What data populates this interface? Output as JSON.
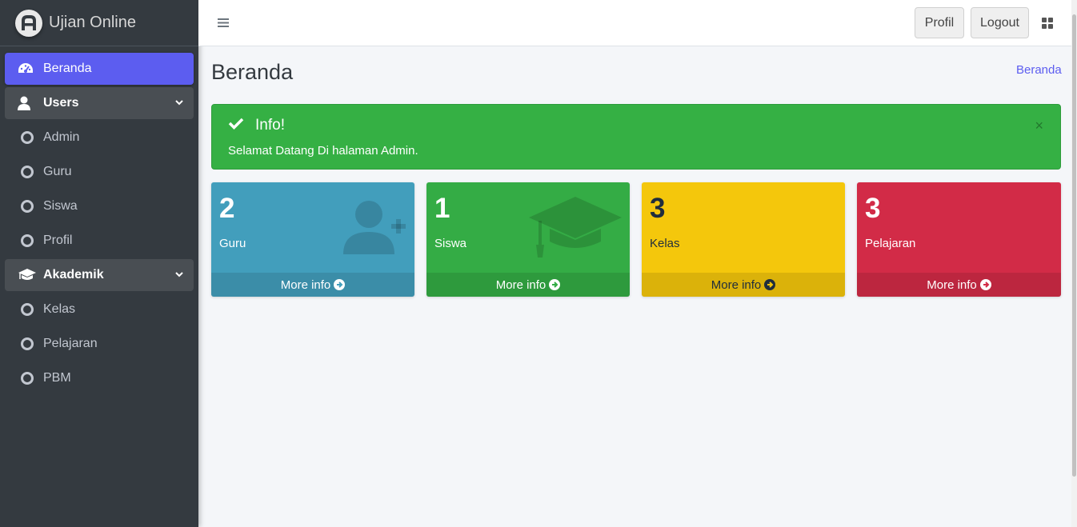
{
  "brand": {
    "name": "Ujian Online"
  },
  "sidebar": {
    "items": [
      {
        "label": "Beranda",
        "icon": "dashboard-icon",
        "state": "active"
      },
      {
        "label": "Users",
        "icon": "user-icon",
        "state": "open"
      },
      {
        "label": "Admin",
        "icon": "circle-icon"
      },
      {
        "label": "Guru",
        "icon": "circle-icon"
      },
      {
        "label": "Siswa",
        "icon": "circle-icon"
      },
      {
        "label": "Profil",
        "icon": "circle-icon"
      },
      {
        "label": "Akademik",
        "icon": "graduation-cap-icon",
        "state": "open"
      },
      {
        "label": "Kelas",
        "icon": "circle-icon"
      },
      {
        "label": "Pelajaran",
        "icon": "circle-icon"
      },
      {
        "label": "PBM",
        "icon": "circle-icon"
      }
    ]
  },
  "topbar": {
    "profil_label": "Profil",
    "logout_label": "Logout"
  },
  "page": {
    "title": "Beranda",
    "breadcrumb": "Beranda"
  },
  "alert": {
    "title": "Info!",
    "message": "Selamat Datang Di halaman Admin.",
    "close": "×"
  },
  "stats": [
    {
      "value": "2",
      "label": "Guru",
      "link": "More info",
      "color": "#429ebc"
    },
    {
      "value": "1",
      "label": "Siswa",
      "link": "More info",
      "color": "#34ac45"
    },
    {
      "value": "3",
      "label": "Kelas",
      "link": "More info",
      "color": "#f4c70c"
    },
    {
      "value": "3",
      "label": "Pelajaran",
      "link": "More info",
      "color": "#d22b47"
    }
  ],
  "colors": {
    "sidebar_bg": "#343a40",
    "active": "#5c5df0",
    "success": "#35b044"
  }
}
